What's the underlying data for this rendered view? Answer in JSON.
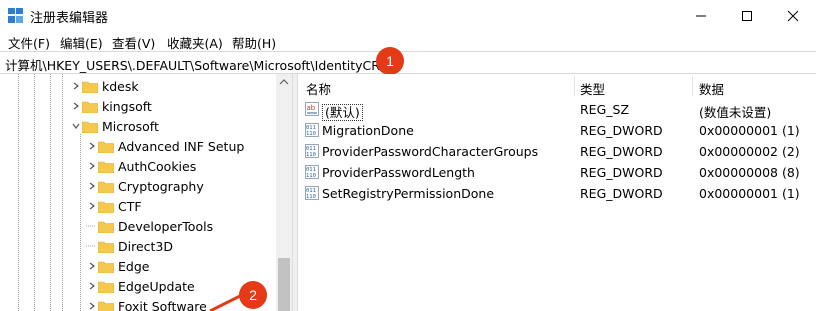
{
  "window": {
    "title": "注册表编辑器",
    "controls": [
      "minimize",
      "maximize",
      "close"
    ]
  },
  "menu": [
    "文件(F)",
    "编辑(E)",
    "查看(V)",
    "收藏夹(A)",
    "帮助(H)"
  ],
  "address": {
    "path": "计算机\\HKEY_USERS\\.DEFAULT\\Software\\Microsoft\\IdentityCRL"
  },
  "badges": [
    "1",
    "2"
  ],
  "tree": {
    "items": [
      {
        "label": "kdesk",
        "expand": "collapsed"
      },
      {
        "label": "kingsoft",
        "expand": "collapsed"
      },
      {
        "label": "Microsoft",
        "expand": "expanded"
      },
      {
        "label": "Advanced INF Setup",
        "expand": "collapsed"
      },
      {
        "label": "AuthCookies",
        "expand": "collapsed"
      },
      {
        "label": "Cryptography",
        "expand": "collapsed"
      },
      {
        "label": "CTF",
        "expand": "collapsed"
      },
      {
        "label": "DeveloperTools",
        "expand": "none"
      },
      {
        "label": "Direct3D",
        "expand": "none"
      },
      {
        "label": "Edge",
        "expand": "collapsed"
      },
      {
        "label": "EdgeUpdate",
        "expand": "collapsed"
      },
      {
        "label": "Foxit Software",
        "expand": "collapsed"
      }
    ]
  },
  "list": {
    "columns": [
      "名称",
      "类型",
      "数据"
    ],
    "rows": [
      {
        "icon": "string-value-icon",
        "name": "(默认)",
        "type": "REG_SZ",
        "data": "(数值未设置)"
      },
      {
        "icon": "binary-value-icon",
        "name": "MigrationDone",
        "type": "REG_DWORD",
        "data": "0x00000001 (1)"
      },
      {
        "icon": "binary-value-icon",
        "name": "ProviderPasswordCharacterGroups",
        "type": "REG_DWORD",
        "data": "0x00000002 (2)"
      },
      {
        "icon": "binary-value-icon",
        "name": "ProviderPasswordLength",
        "type": "REG_DWORD",
        "data": "0x00000008 (8)"
      },
      {
        "icon": "binary-value-icon",
        "name": "SetRegistryPermissionDone",
        "type": "REG_DWORD",
        "data": "0x00000001 (1)"
      }
    ]
  },
  "colors": {
    "badge": "#e53a17",
    "folder": "#f5c84f",
    "folder_dark": "#e0a93a"
  }
}
